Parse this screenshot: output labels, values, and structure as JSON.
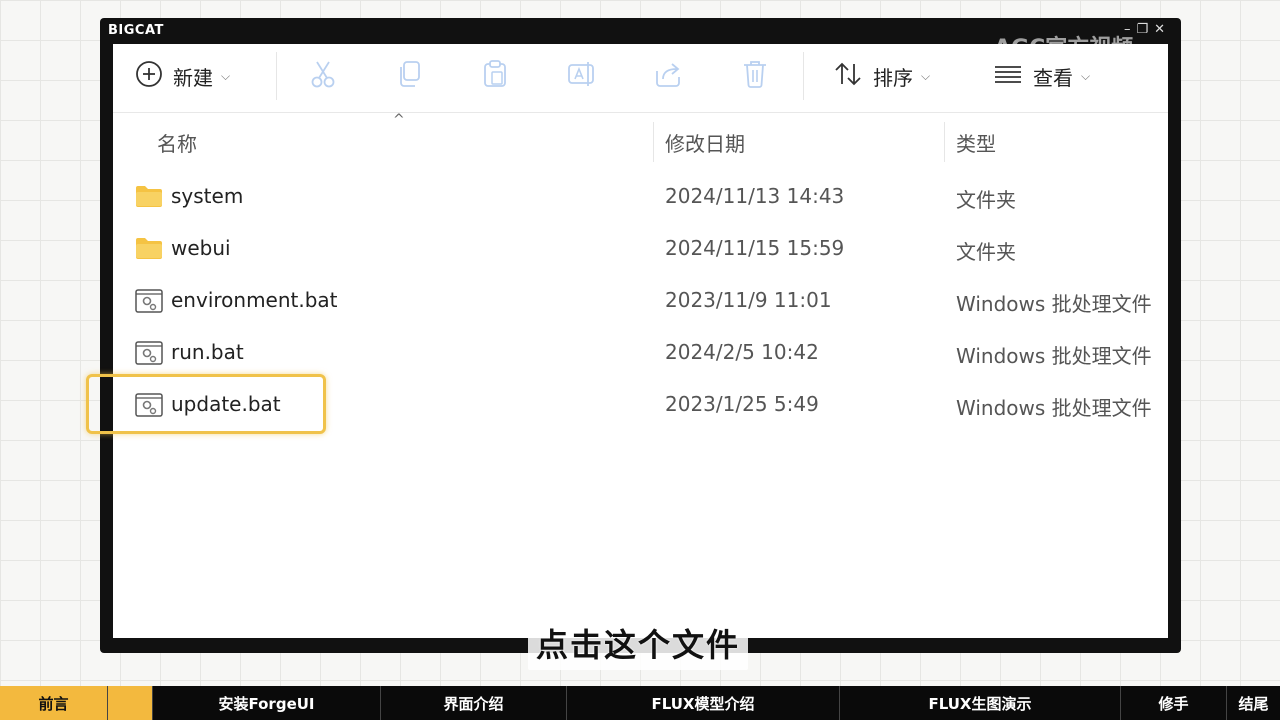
{
  "frame": {
    "title": "BIGCAT"
  },
  "watermark": "AGC官方视频",
  "toolbar": {
    "new_label": "新建",
    "sort_label": "排序",
    "view_label": "查看"
  },
  "columns": {
    "name": "名称",
    "date": "修改日期",
    "type": "类型"
  },
  "files": [
    {
      "name": "system",
      "date": "2024/11/13 14:43",
      "type": "文件夹",
      "icon": "folder-icon"
    },
    {
      "name": "webui",
      "date": "2024/11/15 15:59",
      "type": "文件夹",
      "icon": "folder-icon"
    },
    {
      "name": "environment.bat",
      "date": "2023/11/9 11:01",
      "type": "Windows 批处理文件",
      "icon": "batch-file-icon"
    },
    {
      "name": "run.bat",
      "date": "2024/2/5 10:42",
      "type": "Windows 批处理文件",
      "icon": "batch-file-icon"
    },
    {
      "name": "update.bat",
      "date": "2023/1/25 5:49",
      "type": "Windows 批处理文件",
      "icon": "batch-file-icon"
    }
  ],
  "subtitle": "点击这个文件",
  "chapters": [
    {
      "label": "前言"
    },
    {
      "label": ""
    },
    {
      "label": "安装ForgeUI"
    },
    {
      "label": "界面介绍"
    },
    {
      "label": "FLUX模型介绍"
    },
    {
      "label": "FLUX生图演示"
    },
    {
      "label": "修手"
    },
    {
      "label": "结尾"
    }
  ],
  "colors": {
    "accent": "#f3b93e",
    "highlight": "#f0c24a",
    "folder": "#f5c343"
  }
}
